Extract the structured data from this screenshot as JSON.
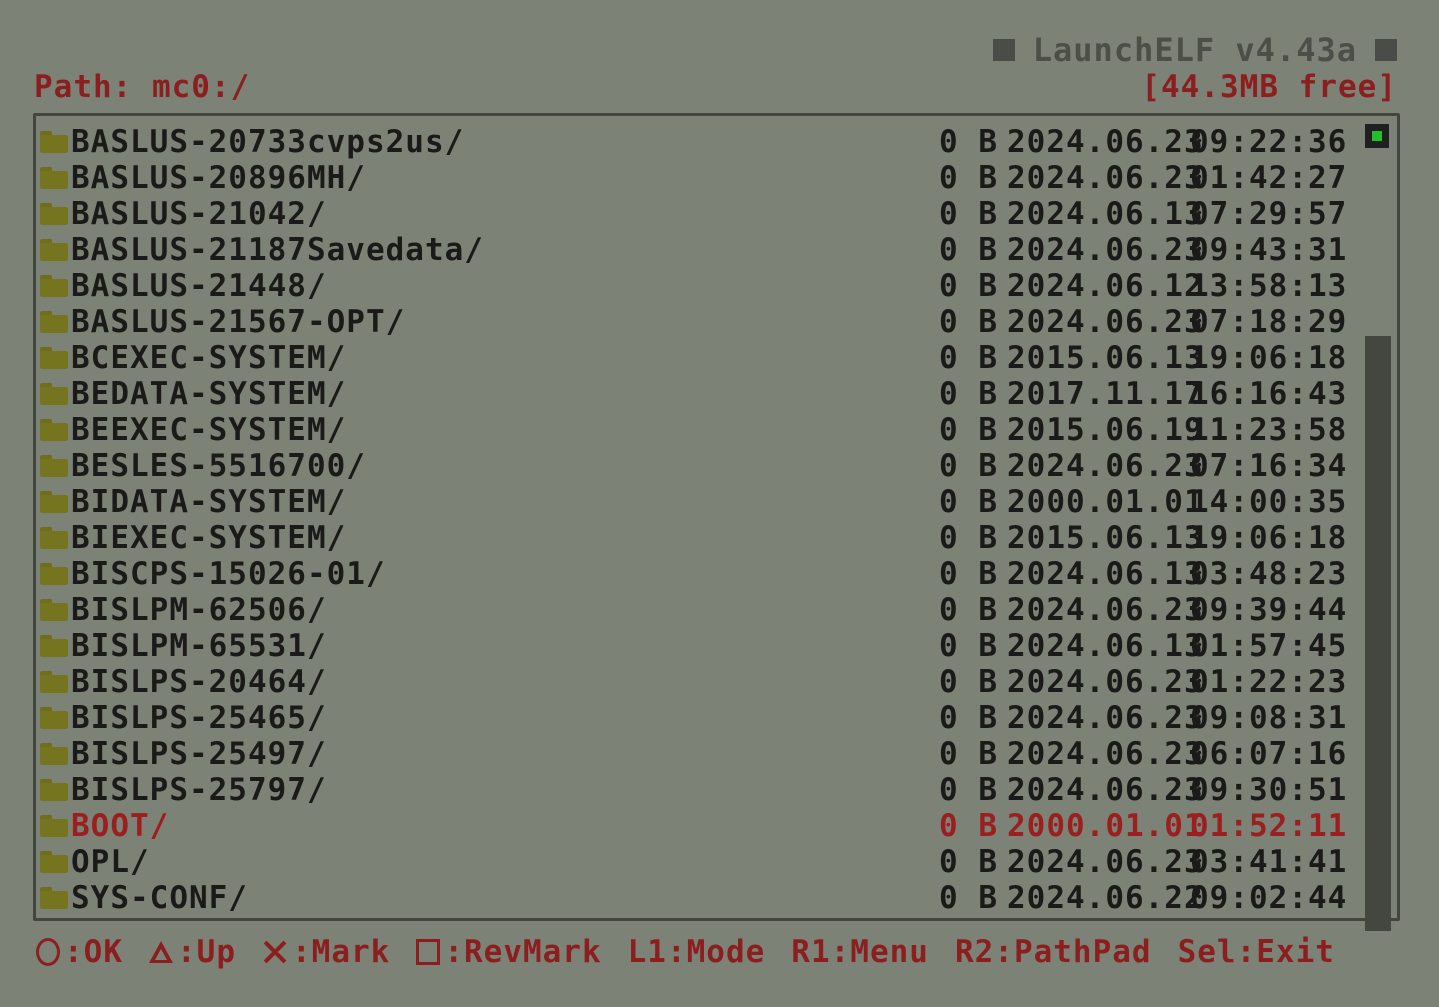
{
  "app": {
    "title": "LaunchELF v4.43a"
  },
  "header": {
    "path_label": "Path: mc0:/",
    "free_space": "[44.3MB free]"
  },
  "files": [
    {
      "name": "BASLUS-20733cvps2us/",
      "size": "0 B",
      "date": "2024.06.23",
      "time": "09:22:36",
      "highlighted": false
    },
    {
      "name": "BASLUS-20896MH/",
      "size": "0 B",
      "date": "2024.06.23",
      "time": "01:42:27",
      "highlighted": false
    },
    {
      "name": "BASLUS-21042/",
      "size": "0 B",
      "date": "2024.06.13",
      "time": "07:29:57",
      "highlighted": false
    },
    {
      "name": "BASLUS-21187Savedata/",
      "size": "0 B",
      "date": "2024.06.23",
      "time": "09:43:31",
      "highlighted": false
    },
    {
      "name": "BASLUS-21448/",
      "size": "0 B",
      "date": "2024.06.12",
      "time": "13:58:13",
      "highlighted": false
    },
    {
      "name": "BASLUS-21567-OPT/",
      "size": "0 B",
      "date": "2024.06.23",
      "time": "07:18:29",
      "highlighted": false
    },
    {
      "name": "BCEXEC-SYSTEM/",
      "size": "0 B",
      "date": "2015.06.13",
      "time": "19:06:18",
      "highlighted": false
    },
    {
      "name": "BEDATA-SYSTEM/",
      "size": "0 B",
      "date": "2017.11.17",
      "time": "16:16:43",
      "highlighted": false
    },
    {
      "name": "BEEXEC-SYSTEM/",
      "size": "0 B",
      "date": "2015.06.19",
      "time": "11:23:58",
      "highlighted": false
    },
    {
      "name": "BESLES-5516700/",
      "size": "0 B",
      "date": "2024.06.23",
      "time": "07:16:34",
      "highlighted": false
    },
    {
      "name": "BIDATA-SYSTEM/",
      "size": "0 B",
      "date": "2000.01.01",
      "time": "14:00:35",
      "highlighted": false
    },
    {
      "name": "BIEXEC-SYSTEM/",
      "size": "0 B",
      "date": "2015.06.13",
      "time": "19:06:18",
      "highlighted": false
    },
    {
      "name": "BISCPS-15026-01/",
      "size": "0 B",
      "date": "2024.06.13",
      "time": "03:48:23",
      "highlighted": false
    },
    {
      "name": "BISLPM-62506/",
      "size": "0 B",
      "date": "2024.06.23",
      "time": "09:39:44",
      "highlighted": false
    },
    {
      "name": "BISLPM-65531/",
      "size": "0 B",
      "date": "2024.06.13",
      "time": "01:57:45",
      "highlighted": false
    },
    {
      "name": "BISLPS-20464/",
      "size": "0 B",
      "date": "2024.06.23",
      "time": "01:22:23",
      "highlighted": false
    },
    {
      "name": "BISLPS-25465/",
      "size": "0 B",
      "date": "2024.06.23",
      "time": "09:08:31",
      "highlighted": false
    },
    {
      "name": "BISLPS-25497/",
      "size": "0 B",
      "date": "2024.06.23",
      "time": "06:07:16",
      "highlighted": false
    },
    {
      "name": "BISLPS-25797/",
      "size": "0 B",
      "date": "2024.06.23",
      "time": "09:30:51",
      "highlighted": false
    },
    {
      "name": "BOOT/",
      "size": "0 B",
      "date": "2000.01.01",
      "time": "01:52:11",
      "highlighted": true
    },
    {
      "name": "OPL/",
      "size": "0 B",
      "date": "2024.06.23",
      "time": "03:41:41",
      "highlighted": false
    },
    {
      "name": "SYS-CONF/",
      "size": "0 B",
      "date": "2024.06.22",
      "time": "09:02:44",
      "highlighted": false
    }
  ],
  "footer": {
    "hints": [
      {
        "button": "circle",
        "icon": "circle-button-icon",
        "label": ":OK"
      },
      {
        "button": "triangle",
        "icon": "triangle-button-icon",
        "label": ":Up"
      },
      {
        "button": "cross",
        "icon": "cross-button-icon",
        "label": ":Mark"
      },
      {
        "button": "square",
        "icon": "square-button-icon",
        "label": ":RevMark"
      },
      {
        "button": "",
        "icon": "",
        "label": "L1:Mode"
      },
      {
        "button": "",
        "icon": "",
        "label": "R1:Menu"
      },
      {
        "button": "",
        "icon": "",
        "label": "R2:PathPad"
      },
      {
        "button": "",
        "icon": "",
        "label": "Sel:Exit"
      }
    ]
  },
  "colors": {
    "background": "#7d8276",
    "text": "#1a1b18",
    "accent_red": "#8b1f1f",
    "folder": "#76751f",
    "scroll_indicator": "#22c02a"
  }
}
